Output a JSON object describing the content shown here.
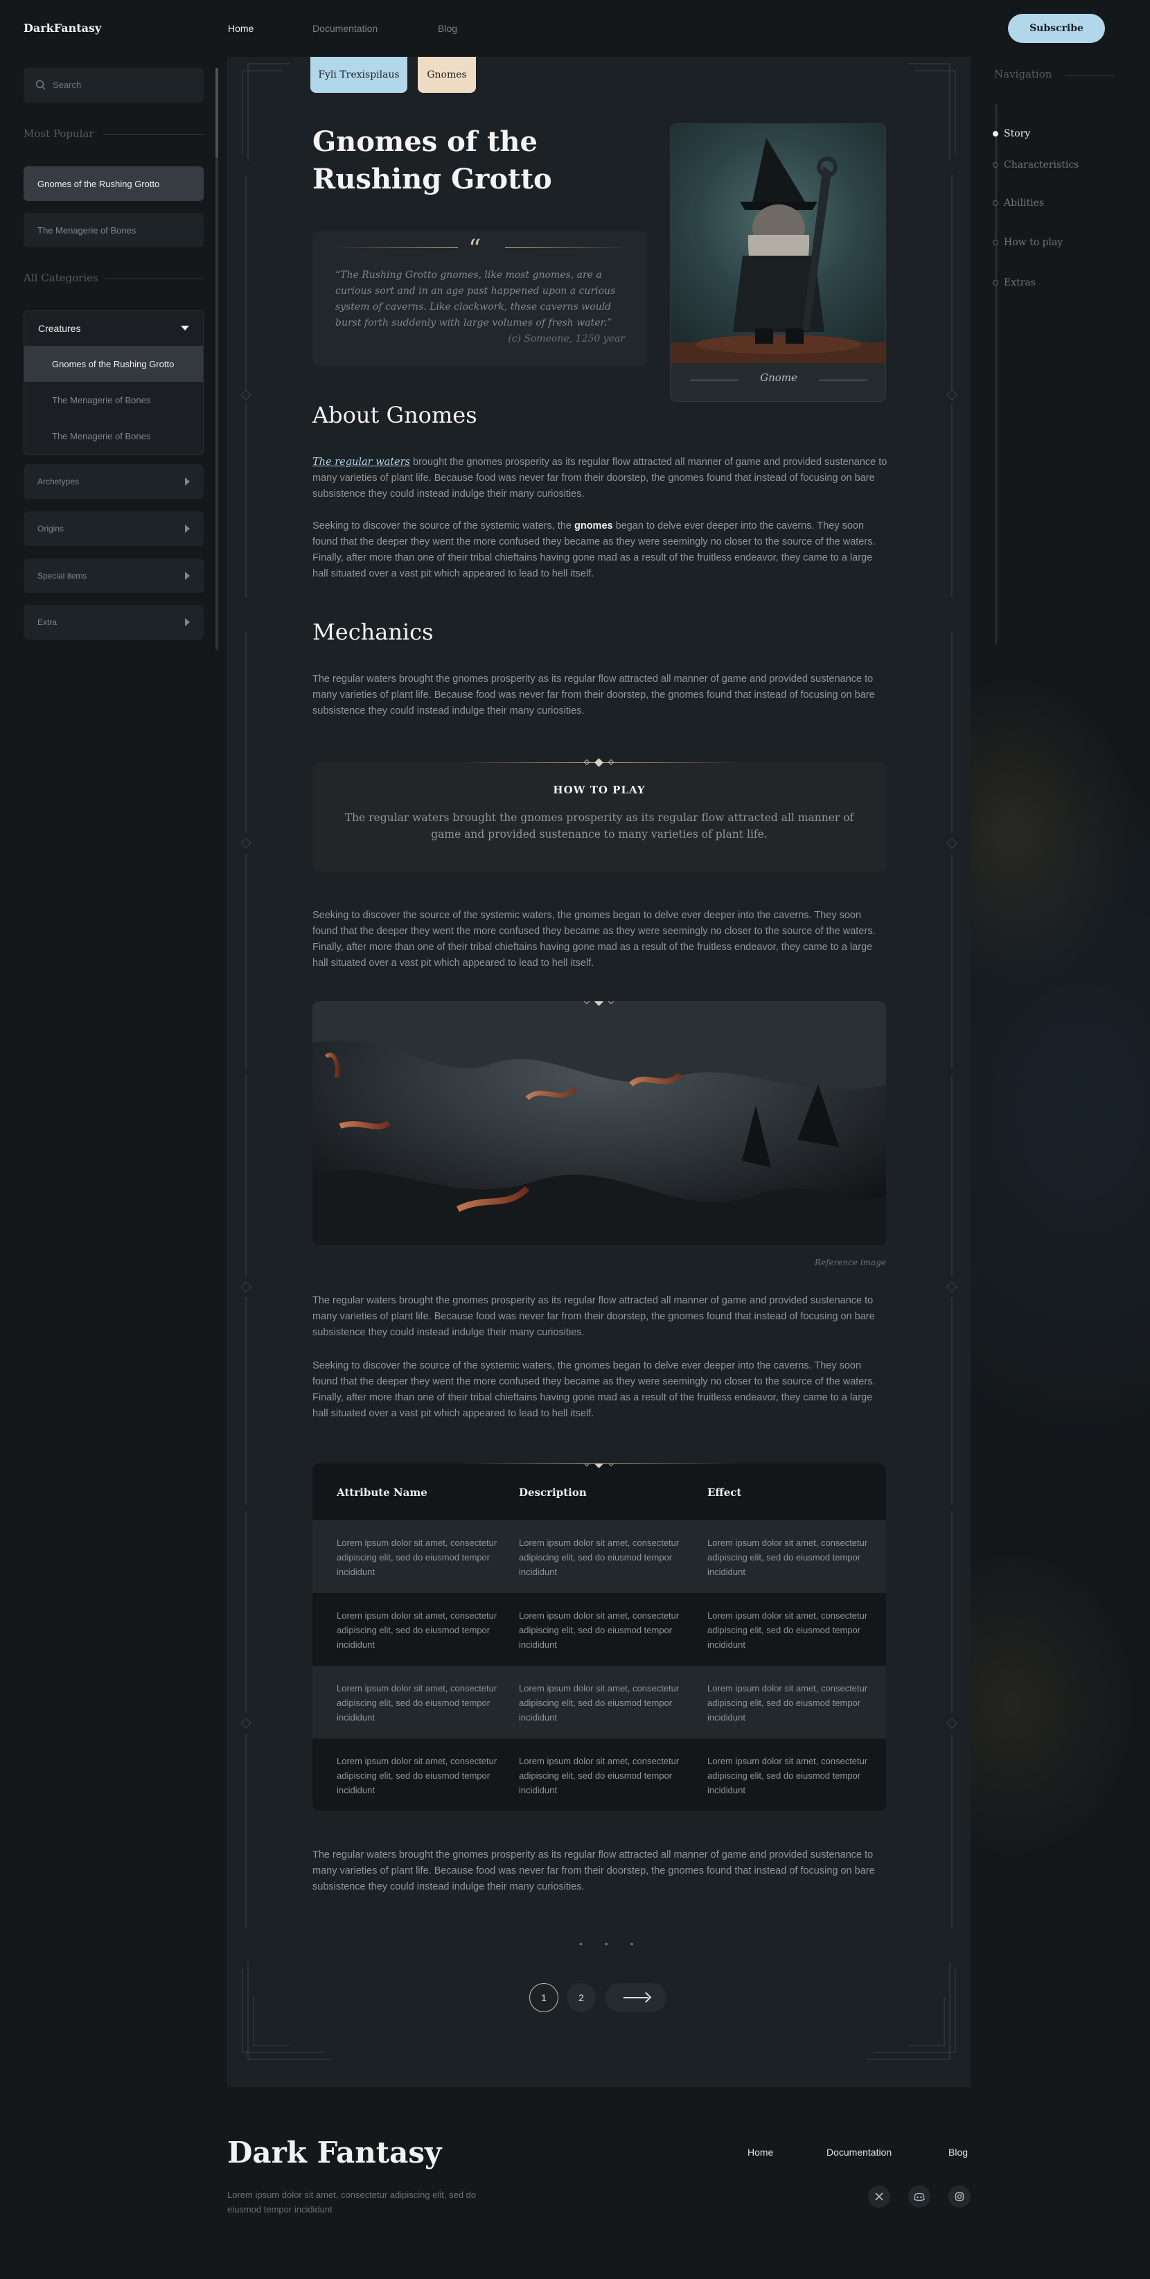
{
  "topbar": {
    "brand": "DarkFantasy",
    "nav": [
      "Home",
      "Documentation",
      "Blog"
    ],
    "subscribe": "Subscribe"
  },
  "sidebar": {
    "search_placeholder": "Search",
    "most_popular_title": "Most Popular",
    "popular": [
      "Gnomes of the Rushing Grotto",
      "The Menagerie of Bones"
    ],
    "all_categories_title": "All Categories",
    "category_open": "Creatures",
    "category_items": [
      "Gnomes of the Rushing Grotto",
      "The Menagerie of Bones",
      "The Menagerie of Bones"
    ],
    "collapsed": [
      "Archetypes",
      "Origins",
      "Special items",
      "Extra"
    ]
  },
  "article": {
    "tags": [
      "Fyli Trexispilaus",
      "Gnomes"
    ],
    "title": "Gnomes of the Rushing Grotto",
    "quote": "“The Rushing Grotto gnomes, like most gnomes, are a curious sort and in an age past happened upon a curious system of caverns. Like clockwork, these caverns would burst forth suddenly with large volumes of fresh water.”",
    "quote_source": "(c) Someone, 1250 year",
    "figure_caption": "Gnome",
    "about_heading": "About Gnomes",
    "about_p1_link": "The regular waters",
    "about_p1_rest": " brought the gnomes prosperity as its regular flow attracted all manner of game and provided sustenance to many varieties of plant life. Because food was never far from their doorstep, the gnomes found that instead of focusing on bare subsistence they could instead indulge their many curiosities.",
    "about_p2_a": "Seeking to discover the source of the systemic waters, the ",
    "about_p2_bold": "gnomes",
    "about_p2_b": " began to delve ever deeper into the caverns. They soon found that the deeper they went the more confused they became as they were seemingly no closer to the source of the waters. Finally, after more than one of their tribal chieftains having gone mad as a result of the fruitless endeavor, they came to a large hall situated over a vast pit which appeared to lead to hell itself.",
    "mechanics_heading": "Mechanics",
    "mech_p1": "The regular waters brought the gnomes prosperity as its regular flow attracted all manner of game and provided sustenance to many varieties of plant life. Because food was never far from their doorstep, the gnomes found that instead of focusing on bare subsistence they could instead indulge their many curiosities.",
    "howto_heading": "HOW TO PLAY",
    "howto_text": "The regular waters brought the gnomes prosperity as its regular flow attracted all manner of game and provided sustenance to many varieties of plant life.",
    "mech_p2": "Seeking to discover the source of the systemic waters, the gnomes began to delve ever deeper into the caverns. They soon found that the deeper they went the more confused they became as they were seemingly no closer to the source of the waters. Finally, after more than one of their tribal chieftains having gone mad as a result of the fruitless endeavor, they came to a large hall situated over a vast pit which appeared to lead to hell itself.",
    "image_caption": "Reference image",
    "mech_p3": "The regular waters brought the gnomes prosperity as its regular flow attracted all manner of game and provided sustenance to many varieties of plant life. Because food was never far from their doorstep, the gnomes found that instead of focusing on bare subsistence they could instead indulge their many curiosities.",
    "mech_p4": "Seeking to discover the source of the systemic waters, the gnomes began to delve ever deeper into the caverns. They soon found that the deeper they went the more confused they became as they were seemingly no closer to the source of the waters. Finally, after more than one of their tribal chieftains having gone mad as a result of the fruitless endeavor, they came to a large hall situated over a vast pit which appeared to lead to hell itself.",
    "table": {
      "headers": [
        "Attribute Name",
        "Description",
        "Effect"
      ],
      "cell": "Lorem ipsum dolor sit amet, consectetur adipiscing elit, sed do eiusmod tempor incididunt"
    },
    "final_p": "The regular waters brought the gnomes prosperity as its regular flow attracted all manner of game and provided sustenance to many varieties of plant life. Because food was never far from their doorstep, the gnomes found that instead of focusing on bare subsistence they could instead indulge their many curiosities.",
    "dots": "• • •",
    "pagination": [
      "1",
      "2"
    ]
  },
  "right_nav": {
    "title": "Navigation",
    "items": [
      "Story",
      "Characteristics",
      "Abilities",
      "How to play",
      "Extras"
    ]
  },
  "footer": {
    "brand": "Dark Fantasy",
    "desc": "Lorem ipsum dolor sit amet, consectetur adipiscing elit, sed do eiusmod tempor incididunt",
    "links": [
      "Home",
      "Documentation",
      "Blog"
    ],
    "social_icons": [
      "x-icon",
      "discord-icon",
      "instagram-icon"
    ]
  }
}
